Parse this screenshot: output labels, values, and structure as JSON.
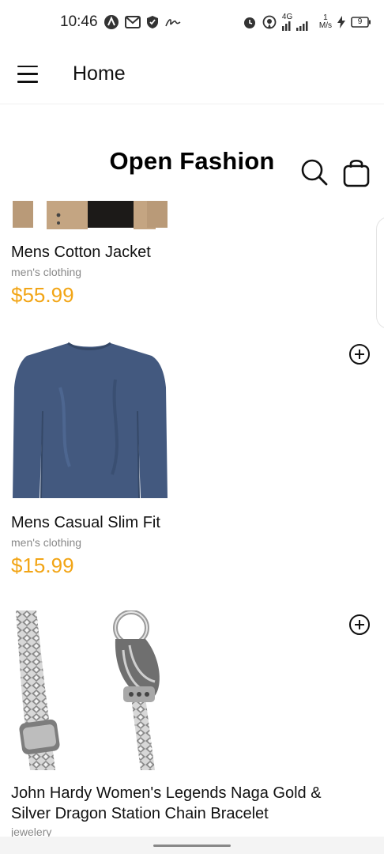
{
  "status_bar": {
    "time": "10:46",
    "network": "4G",
    "speed_value": "1",
    "speed_unit": "M/s",
    "battery": "9",
    "icons": [
      "auto-icon",
      "gmail-icon",
      "shield-icon",
      "signature-icon",
      "alarm-icon",
      "hotspot-icon",
      "signal-icon",
      "charging-icon",
      "battery-icon"
    ]
  },
  "app_bar": {
    "title": "Home",
    "menu_icon": "hamburger-menu-icon"
  },
  "brand": {
    "title": "Open Fashion",
    "search_icon": "search-icon",
    "bag_icon": "shopping-bag-icon"
  },
  "products": [
    {
      "name": "Mens Cotton Jacket",
      "category": "men's clothing",
      "price": "$55.99",
      "image": "jacket-image"
    },
    {
      "name": "Mens Casual Slim Fit",
      "category": "men's clothing",
      "price": "$15.99",
      "image": "long-sleeve-shirt-image"
    },
    {
      "name": "John Hardy Women's Legends Naga Gold & Silver Dragon Station Chain Bracelet",
      "category": "jewelery",
      "price": "",
      "image": "bracelet-image"
    }
  ],
  "colors": {
    "price": "#f2a516",
    "category": "#888888",
    "text": "#111111",
    "shirt": "#43597f"
  }
}
